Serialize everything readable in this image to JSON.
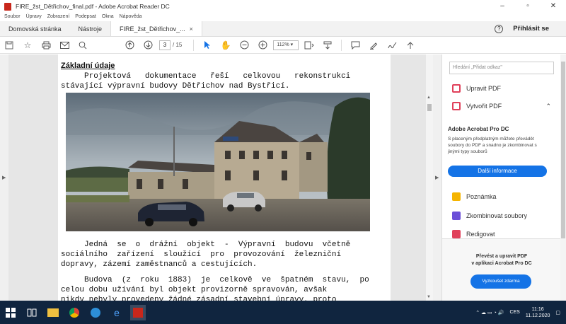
{
  "window": {
    "title": "FIRE_žst_Dětřichov_final.pdf - Adobe Acrobat Reader DC",
    "minimize": "–",
    "maximize": "▫",
    "close": "✕"
  },
  "menu": [
    "Soubor",
    "Úpravy",
    "Zobrazení",
    "Podepsat",
    "Okna",
    "Nápověda"
  ],
  "tabs": {
    "home": "Domovská stránka",
    "tools": "Nástroje",
    "doc": "FIRE_žst_Dětřichov_...",
    "doc_close": "×"
  },
  "header_right": {
    "help": "?",
    "signin": "Přihlásit se"
  },
  "toolbar": {
    "page_current": "3",
    "page_total": "/ 15",
    "zoom": "112%"
  },
  "document": {
    "heading": "Základní údaje",
    "para1": "     Projektová   dokumentace   řeší   celkovou   rekonstrukci\nstávající výpravní budovy Dětřichov nad Bystřicí.",
    "para2": "     Jedná  se  o  drážní  objekt  -  Výpravní  budovu  včetně\nsociálního  zařízení  sloužící  pro  provozování  železniční\ndopravy, zázemí zaměstnanců a cestujících.",
    "para3": "     Budova  (z  roku  1883)  je  celkově  ve  špatném  stavu,  po\ncelou dobu užívání byl objekt provizorně spravován, avšak\nnikdy nebyly provedeny žádné zásadní stavební úpravy, proto"
  },
  "right_panel": {
    "search_placeholder": "Hledání „Přidat odkaz\"",
    "edit_pdf": "Upravit PDF",
    "create_pdf": "Vytvořit PDF",
    "create_pdf_chevron": "⌃",
    "promo_title": "Adobe Acrobat Pro DC",
    "promo_text": "S placeným předplatným můžete převádět soubory do PDF a snadno je zkombinovat s jinými typy souborů",
    "promo_button": "Další informace",
    "comment": "Poznámka",
    "combine": "Zkombinovat soubory",
    "redact": "Redigovat",
    "bottom_text": "Převést a upravit PDF\nv aplikaci Acrobat Pro DC",
    "bottom_button": "Vyzkoušet zdarma"
  },
  "taskbar": {
    "lang": "CES",
    "time": "11:16",
    "date": "11.12.2020"
  }
}
